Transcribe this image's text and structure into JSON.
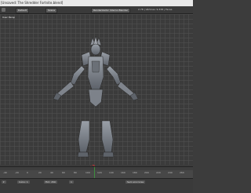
{
  "window": {
    "title": "[Unsaved: The Shredder Fortnite.blend]"
  },
  "header": {
    "menu_label": "Default",
    "scene_label": "Scene",
    "render_engine": "Renderizador Interno Blender",
    "status": "2.78 | Vértices: 9.338 | Faces"
  },
  "viewport": {
    "view_label": "User Persp",
    "model_name": "The Shredder armor mesh"
  },
  "timeline": {
    "ticks": [
      "-40",
      "-20",
      "0",
      "20",
      "40",
      "60",
      "80",
      "100",
      "120",
      "140",
      "160",
      "180",
      "200",
      "220",
      "240",
      "260"
    ]
  },
  "playback": {
    "start_label": "Início: 1",
    "end_label": "Fim: 250",
    "frame": "1",
    "sync": "Sem sincronia"
  }
}
